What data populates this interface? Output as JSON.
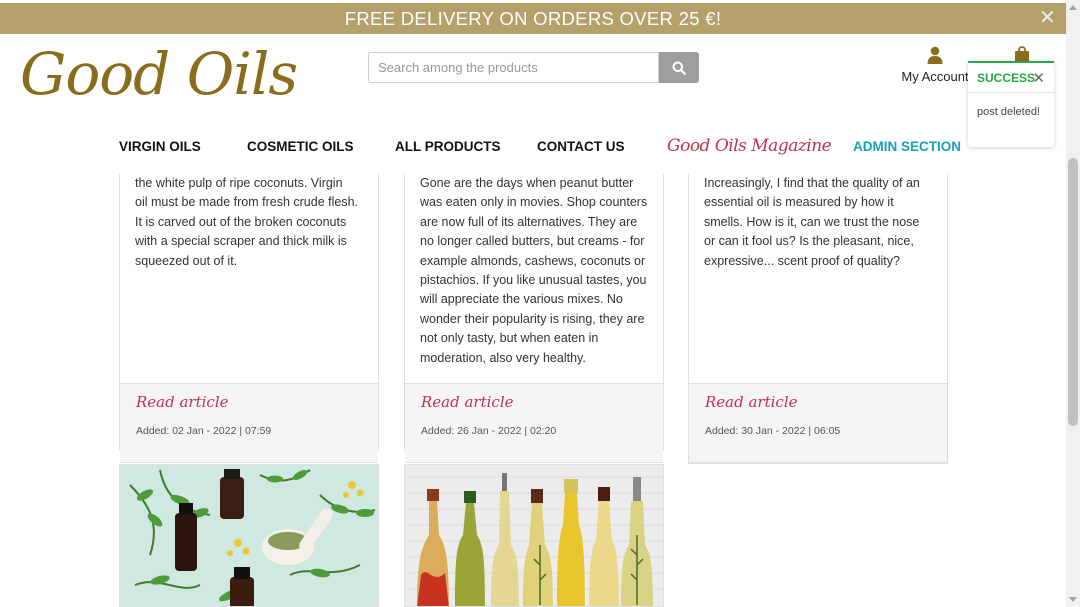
{
  "promo": {
    "text": "FREE DELIVERY ON ORDERS OVER 25 €!",
    "close": "✕"
  },
  "logo": {
    "text": "Good Oils"
  },
  "search": {
    "placeholder": "Search among the products"
  },
  "account": {
    "label": "My Account"
  },
  "toast": {
    "title": "SUCCESS",
    "close": "✕",
    "message": "post deleted!"
  },
  "nav": {
    "items": [
      {
        "label": "VIRGIN OILS"
      },
      {
        "label": "COSMETIC OILS"
      },
      {
        "label": "ALL PRODUCTS"
      },
      {
        "label": "CONTACT US"
      },
      {
        "label": "Good Oils Magazine"
      },
      {
        "label": "ADMIN SECTION"
      }
    ]
  },
  "articles": [
    {
      "lines": [
        "the white pulp of ripe coconuts. Virgin",
        "oil must be made from fresh crude flesh.",
        "It is carved out of the broken coconuts",
        "with a special scraper and thick milk is",
        "squeezed out of it."
      ],
      "link": "Read article",
      "added": "Added: 02 Jan - 2022 | 07:59"
    },
    {
      "lines": [
        "Gone are the days when peanut butter",
        "was eaten only in movies. Shop counters",
        "are now full of its alternatives. They are",
        "no longer called butters, but creams - for",
        "example almonds, cashews, coconuts or",
        "pistachios. If you like unusual tastes, you",
        "will appreciate the various mixes. No",
        "wonder their popularity is rising, they are",
        "not only tasty, but when eaten in",
        "moderation, also very healthy."
      ],
      "link": "Read article",
      "added": "Added: 26 Jan - 2022 | 02:20"
    },
    {
      "lines": [
        "Increasingly, I find that the quality of an",
        "essential oil is measured by how it",
        "smells. How is it, can we trust the nose",
        "or can it fool us? Is the pleasant, nice,",
        "expressive... scent proof of quality?"
      ],
      "link": "Read article",
      "added": "Added: 30 Jan - 2022 | 06:05"
    }
  ],
  "colors": {
    "promo": "#b3a06a",
    "logo": "#8a6d1c",
    "accent": "#c0334d",
    "admin": "#17a2b8",
    "success": "#28a745"
  }
}
